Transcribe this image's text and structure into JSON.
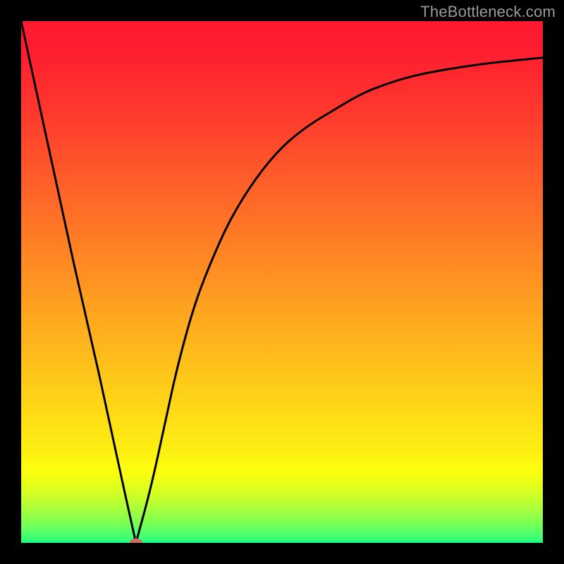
{
  "watermark": "TheBottleneck.com",
  "chart_data": {
    "type": "line",
    "title": "",
    "xlabel": "",
    "ylabel": "",
    "xlim": [
      0,
      100
    ],
    "ylim": [
      0,
      100
    ],
    "x": [
      0,
      5,
      10,
      15,
      20,
      22,
      25,
      28,
      30,
      33,
      36,
      40,
      45,
      50,
      55,
      60,
      65,
      70,
      75,
      80,
      85,
      90,
      95,
      100
    ],
    "values": [
      100,
      77,
      54,
      32,
      9,
      0,
      11,
      25,
      34,
      45,
      53,
      62,
      70,
      76,
      80,
      83,
      86,
      88,
      89.5,
      90.5,
      91.3,
      92,
      92.5,
      93
    ],
    "grid": false,
    "legend": false,
    "background": "red-yellow-green vertical gradient",
    "marker": {
      "x": 22,
      "y": 0,
      "color": "#ca6e61"
    }
  },
  "colors": {
    "curve": "#000000",
    "frame": "#000000",
    "watermark": "#9a9a9a",
    "marker": "#ca6e61"
  }
}
